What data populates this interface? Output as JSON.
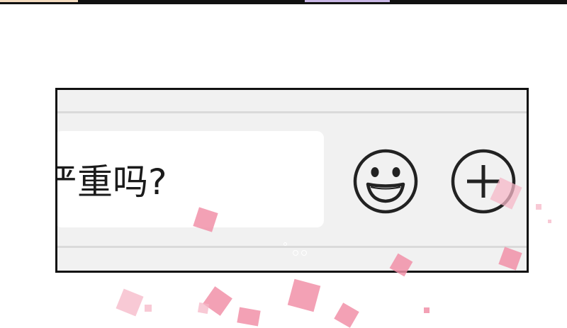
{
  "chat_bar": {
    "input_text": "严重吗?",
    "emoji_button_icon": "smile-icon",
    "add_button_icon": "plus-circle-icon"
  },
  "colors": {
    "panel_background": "#f1f1f1",
    "input_background": "#ffffff",
    "border": "#111111",
    "icon_stroke": "#222222",
    "petal": "#f190a8"
  }
}
